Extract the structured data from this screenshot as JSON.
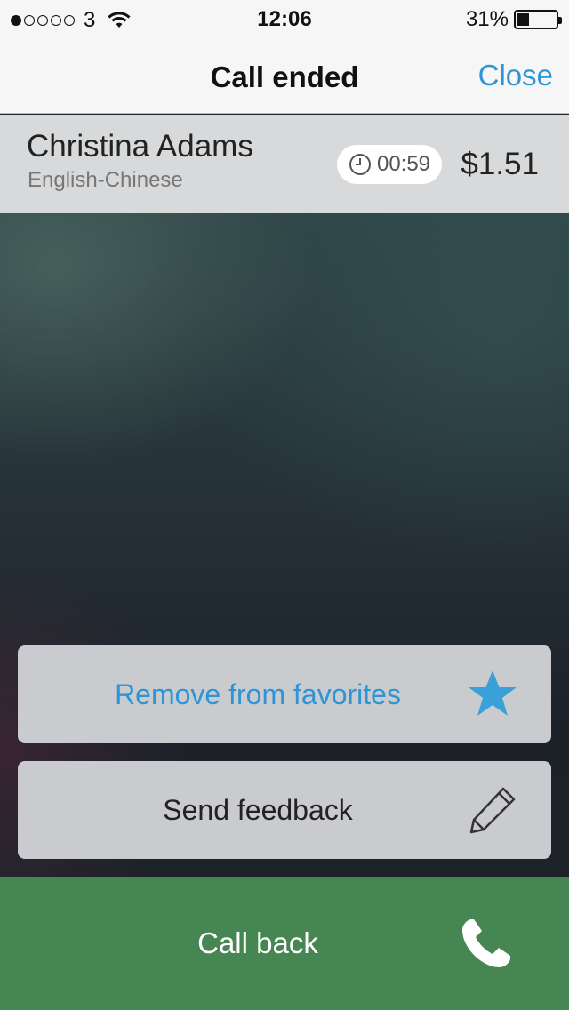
{
  "status_bar": {
    "carrier": "3",
    "time": "12:06",
    "battery": "31%",
    "battery_level": 0.31,
    "signal_bars": 1
  },
  "nav": {
    "title": "Call ended",
    "close_label": "Close"
  },
  "call_info": {
    "name": "Christina Adams",
    "language_pair": "English-Chinese",
    "duration": "00:59",
    "price": "$1.51"
  },
  "actions": {
    "favorites_label": "Remove from favorites",
    "feedback_label": "Send feedback",
    "callback_label": "Call back"
  },
  "icons": {
    "star": "star-icon",
    "pencil": "pencil-icon",
    "phone": "phone-icon",
    "clock": "clock-icon"
  },
  "colors": {
    "accent": "#2d95d6",
    "callback_green": "#468652"
  }
}
